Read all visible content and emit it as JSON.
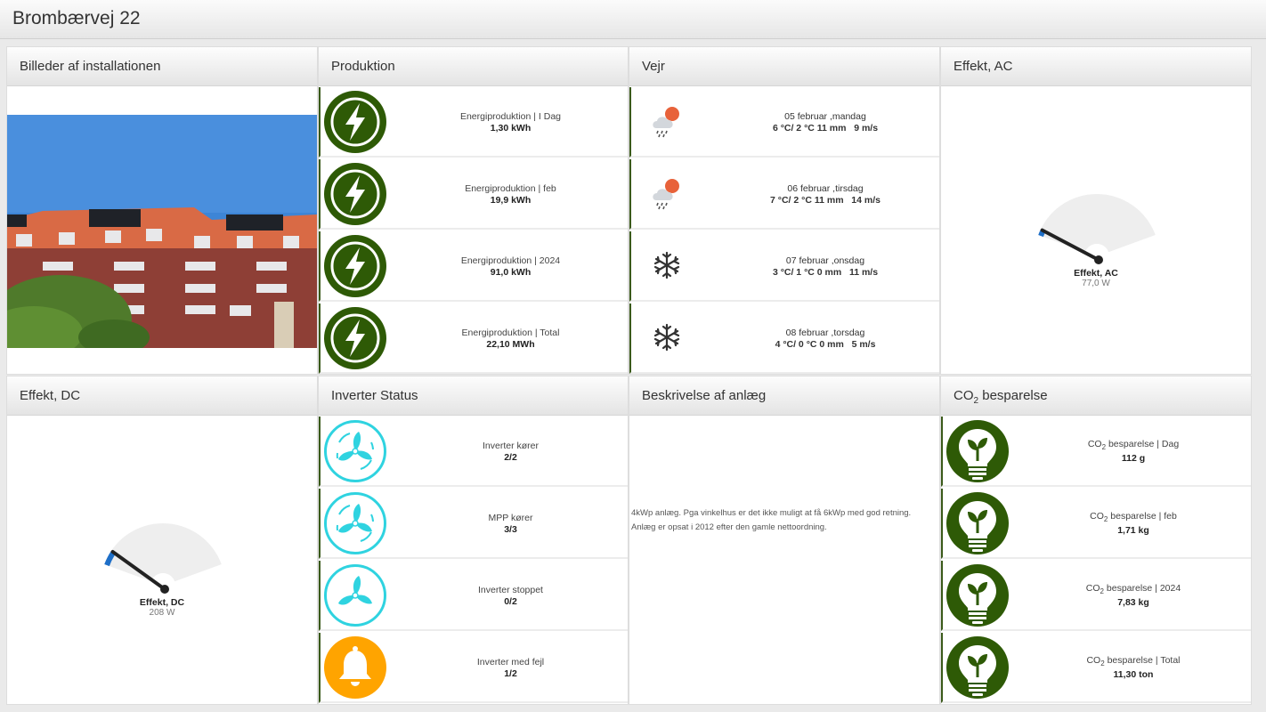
{
  "header": {
    "title": "Brombærvej 22"
  },
  "panels": {
    "pictures": {
      "title": "Billeder af installationen"
    },
    "production": {
      "title": "Produktion",
      "items": [
        {
          "label": "Energiproduktion | I Dag",
          "value": "1,30 kWh",
          "icon": "lightning-bolt-icon"
        },
        {
          "label": "Energiproduktion | feb",
          "value": "19,9 kWh",
          "icon": "lightning-bolt-icon"
        },
        {
          "label": "Energiproduktion | 2024",
          "value": "91,0 kWh",
          "icon": "lightning-bolt-icon"
        },
        {
          "label": "Energiproduktion | Total",
          "value": "22,10 MWh",
          "icon": "lightning-bolt-icon"
        }
      ]
    },
    "weather": {
      "title": "Vejr",
      "items": [
        {
          "date": "05 februar ,mandag",
          "details": "6 °C/ 2 °C 11 mm   9 m/s",
          "icon": "rain-cloud-sun-icon"
        },
        {
          "date": "06 februar ,tirsdag",
          "details": "7 °C/ 2 °C 11 mm   14 m/s",
          "icon": "rain-cloud-sun-icon"
        },
        {
          "date": "07 februar ,onsdag",
          "details": "3 °C/ 1 °C 0 mm   11 m/s",
          "icon": "snowflake-icon"
        },
        {
          "date": "08 februar ,torsdag",
          "details": "4 °C/ 0 °C 0 mm   5 m/s",
          "icon": "snowflake-icon"
        }
      ]
    },
    "effect_ac": {
      "title": "Effekt, AC",
      "gauge_label": "Effekt, AC",
      "gauge_value": "77,0 W",
      "level": 0.04
    },
    "effect_dc": {
      "title": "Effekt, DC",
      "gauge_label": "Effekt, DC",
      "gauge_value": "208 W",
      "level": 0.1
    },
    "inverter": {
      "title": "Inverter Status",
      "items": [
        {
          "label": "Inverter kører",
          "value": "2/2",
          "icon": "fan-arrows-icon"
        },
        {
          "label": "MPP kører",
          "value": "3/3",
          "icon": "fan-arrows-icon"
        },
        {
          "label": "Inverter stoppet",
          "value": "0/2",
          "icon": "fan-icon"
        },
        {
          "label": "Inverter med fejl",
          "value": "1/2",
          "icon": "bell-icon"
        }
      ]
    },
    "description": {
      "title": "Beskrivelse af anlæg",
      "text_line1": "4kWp anlæg. Pga vinkelhus er det ikke muligt at få 6kWp med god retning.",
      "text_line2": "Anlæg er opsat i 2012 efter den gamle nettoordning."
    },
    "co2": {
      "title_prefix": "CO",
      "title_sub": "2",
      "title_suffix": " besparelse",
      "items": [
        {
          "label_prefix": "CO",
          "label_sub": "2",
          "label_suffix": " besparelse | Dag",
          "value": "112 g",
          "icon": "lightbulb-leaf-icon"
        },
        {
          "label_prefix": "CO",
          "label_sub": "2",
          "label_suffix": " besparelse | feb",
          "value": "1,71 kg",
          "icon": "lightbulb-leaf-icon"
        },
        {
          "label_prefix": "CO",
          "label_sub": "2",
          "label_suffix": " besparelse | 2024",
          "value": "7,83 kg",
          "icon": "lightbulb-leaf-icon"
        },
        {
          "label_prefix": "CO",
          "label_sub": "2",
          "label_suffix": " besparelse | Total",
          "value": "11,30 ton",
          "icon": "lightbulb-leaf-icon"
        }
      ]
    }
  },
  "colors": {
    "green": "#2e5a06",
    "cyan": "#2fd3e0",
    "orange": "#ffa400",
    "gauge_needle": "#222222",
    "gauge_blue": "#1e6fc8"
  }
}
